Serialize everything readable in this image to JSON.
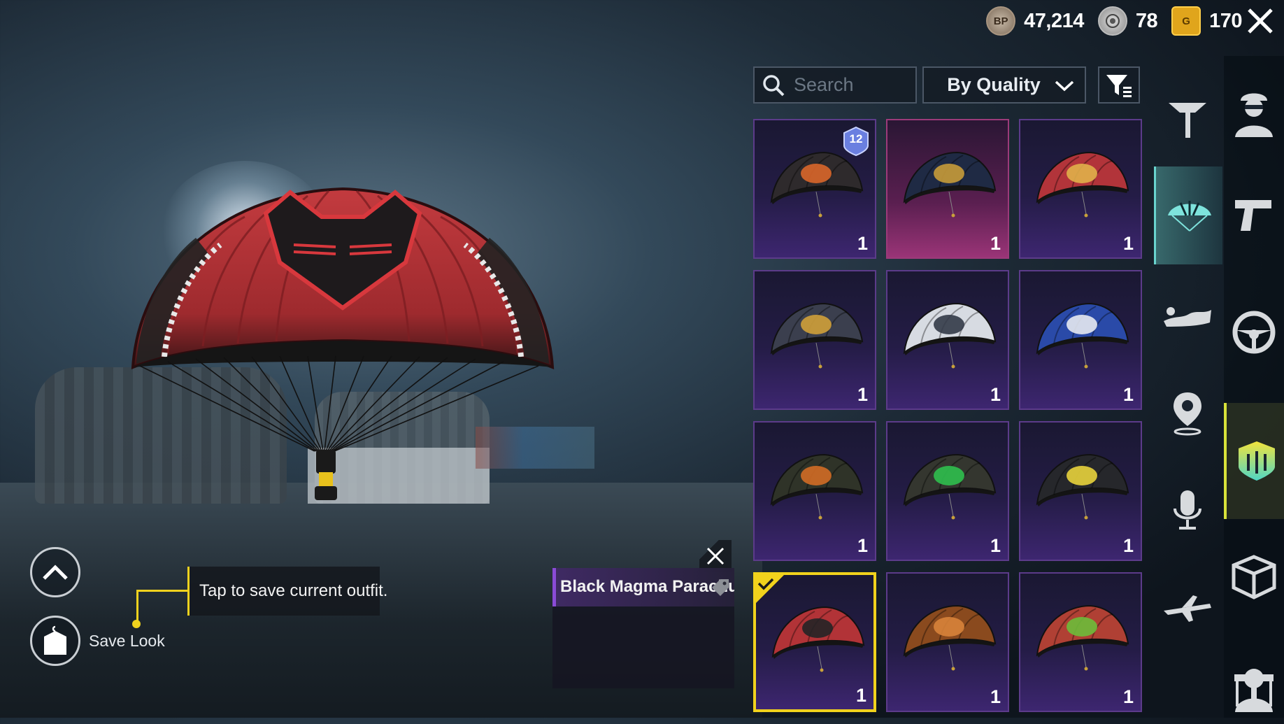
{
  "currency": {
    "bp_icon": "BP",
    "bp_value": "47,214",
    "uc_value": "78",
    "g_icon": "G",
    "g_value": "170"
  },
  "toolbar": {
    "search_placeholder": "Search",
    "sort_value": "By Quality"
  },
  "grid": {
    "items": [
      {
        "count": "1",
        "badge": "12",
        "quality": "purple",
        "colors": [
          "#2e2a2c",
          "#d9662a"
        ]
      },
      {
        "count": "1",
        "quality": "pink",
        "colors": [
          "#1f2a44",
          "#c79b3a"
        ]
      },
      {
        "count": "1",
        "quality": "purple",
        "colors": [
          "#b2343a",
          "#e0b04a"
        ]
      },
      {
        "count": "1",
        "quality": "purple",
        "colors": [
          "#3b3f4e",
          "#d0a03a"
        ]
      },
      {
        "count": "1",
        "quality": "purple",
        "colors": [
          "#d7dbe2",
          "#333a48"
        ]
      },
      {
        "count": "1",
        "quality": "purple",
        "colors": [
          "#2a4aa8",
          "#e6e9f0"
        ]
      },
      {
        "count": "1",
        "quality": "purple",
        "colors": [
          "#2f3328",
          "#d26b25"
        ]
      },
      {
        "count": "1",
        "quality": "purple",
        "colors": [
          "#34362f",
          "#2fbf4e"
        ]
      },
      {
        "count": "1",
        "quality": "purple",
        "colors": [
          "#26272b",
          "#e8d33c"
        ]
      },
      {
        "count": "1",
        "quality": "purple",
        "selected": true,
        "colors": [
          "#b23337",
          "#232326"
        ]
      },
      {
        "count": "1",
        "quality": "purple",
        "colors": [
          "#8a4a1e",
          "#d7833a"
        ]
      },
      {
        "count": "1",
        "quality": "purple",
        "colors": [
          "#b04034",
          "#6dbd3a"
        ]
      }
    ]
  },
  "controls": {
    "save_look_label": "Save Look",
    "tooltip_text": "Tap to save current outfit."
  },
  "detail": {
    "item_name": "Black Magma Parachute"
  },
  "colors": {
    "accent_yellow": "#f0d21e",
    "rail_active_teal": "#69d4cf",
    "rare_purple": "#5c3b8a",
    "epic_pink": "#9c3a7a"
  },
  "rail": {
    "left": [
      "parachute-harness-icon",
      "parachute-icon",
      "swim-icon",
      "location-pin-icon",
      "microphone-icon",
      "airplane-icon"
    ],
    "right": [
      "character-icon",
      "pistol-icon",
      "steering-wheel-icon",
      "emblem-icon",
      "crate-icon",
      "present-icon",
      "avatar-icon"
    ]
  }
}
